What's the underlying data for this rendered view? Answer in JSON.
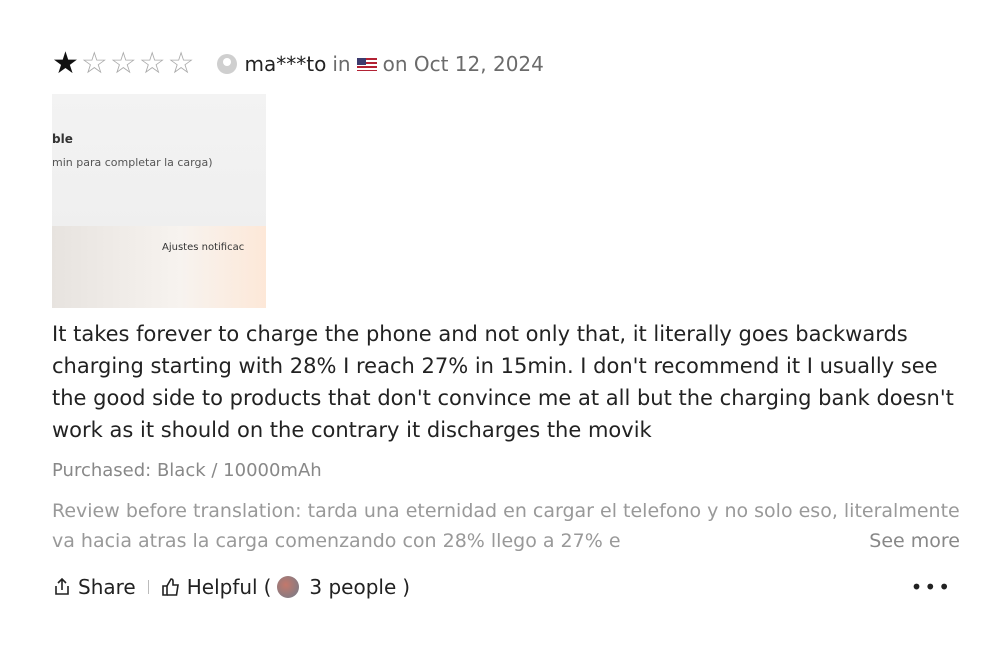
{
  "review": {
    "rating": 1,
    "max_rating": 5,
    "username": "ma***to",
    "in_label": "in",
    "date": "on Oct 12, 2024",
    "photo": {
      "line1": "ble",
      "line2": "min para completar la carga)",
      "line3": "Ajustes notificac"
    },
    "text": "It takes forever to charge the phone and not only that, it literally goes backwards charging starting with 28% I reach 27% in 15min. I don't recommend it I usually see the good side to products that don't convince me at all but the charging bank doesn't work as it should on the contrary it discharges the movik",
    "purchased": "Purchased: Black / 10000mAh",
    "original": "Review before translation: tarda una eternidad en cargar el telefono y no solo eso, literalmente va hacia atras la carga comenzando con 28% llego a 27% e",
    "see_more": "See more",
    "actions": {
      "share": "Share",
      "helpful": "Helpful",
      "helpful_open": "(",
      "helpful_count": "3 people",
      "helpful_close": ")"
    }
  }
}
